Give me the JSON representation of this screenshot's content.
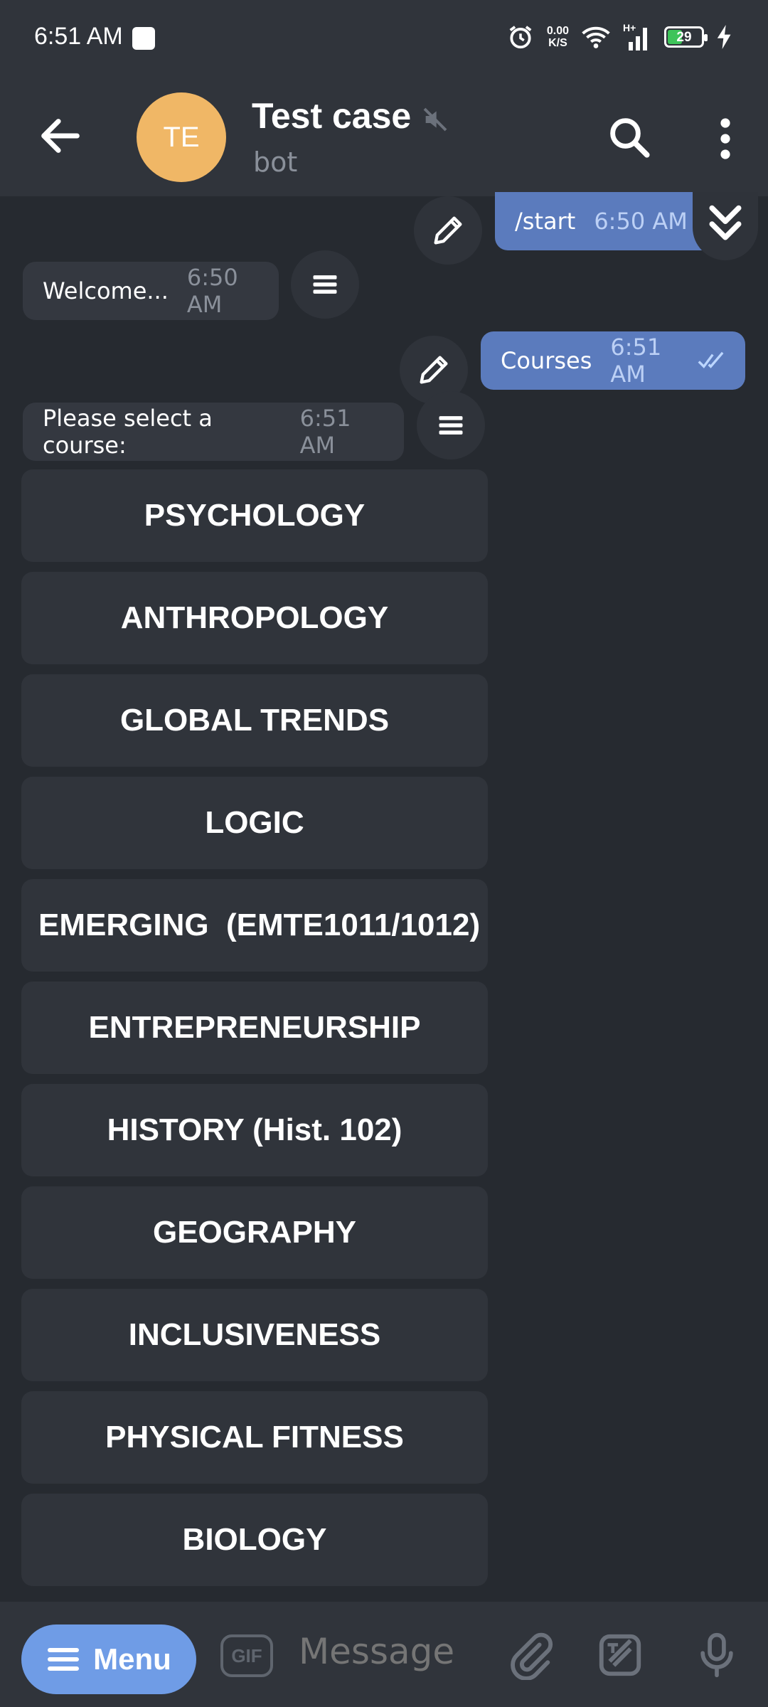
{
  "status_bar": {
    "time": "6:51 AM",
    "speed_value": "0.00",
    "speed_unit": "K/S",
    "network": "H+",
    "battery": "29"
  },
  "header": {
    "avatar_initials": "TE",
    "title": "Test case",
    "subtitle": "bot"
  },
  "messages": [
    {
      "direction": "out",
      "text": "/start",
      "time": "6:50 AM"
    },
    {
      "direction": "in",
      "text": "Welcome...",
      "time": "6:50 AM"
    },
    {
      "direction": "out",
      "text": "Courses",
      "time": "6:51 AM"
    },
    {
      "direction": "in",
      "text": "Please select a course:",
      "time": "6:51 AM"
    }
  ],
  "keyboard_buttons": [
    "PSYCHOLOGY",
    "ANTHROPOLOGY",
    "GLOBAL TRENDS",
    "LOGIC",
    "EMERGING  (EMTE1011/1012)",
    "ENTREPRENEURSHIP",
    "HISTORY (Hist. 102)",
    "GEOGRAPHY",
    "INCLUSIVENESS",
    "PHYSICAL FITNESS",
    "BIOLOGY"
  ],
  "bottom_bar": {
    "menu_label": "Menu",
    "gif_label": "GIF",
    "message_placeholder": "Message"
  },
  "colors": {
    "background": "#262a30",
    "header": "#30343b",
    "outgoing_bubble": "#5b7bbd",
    "incoming_bubble": "#343840",
    "avatar": "#f0b766",
    "menu_button": "#6f9ce6"
  }
}
